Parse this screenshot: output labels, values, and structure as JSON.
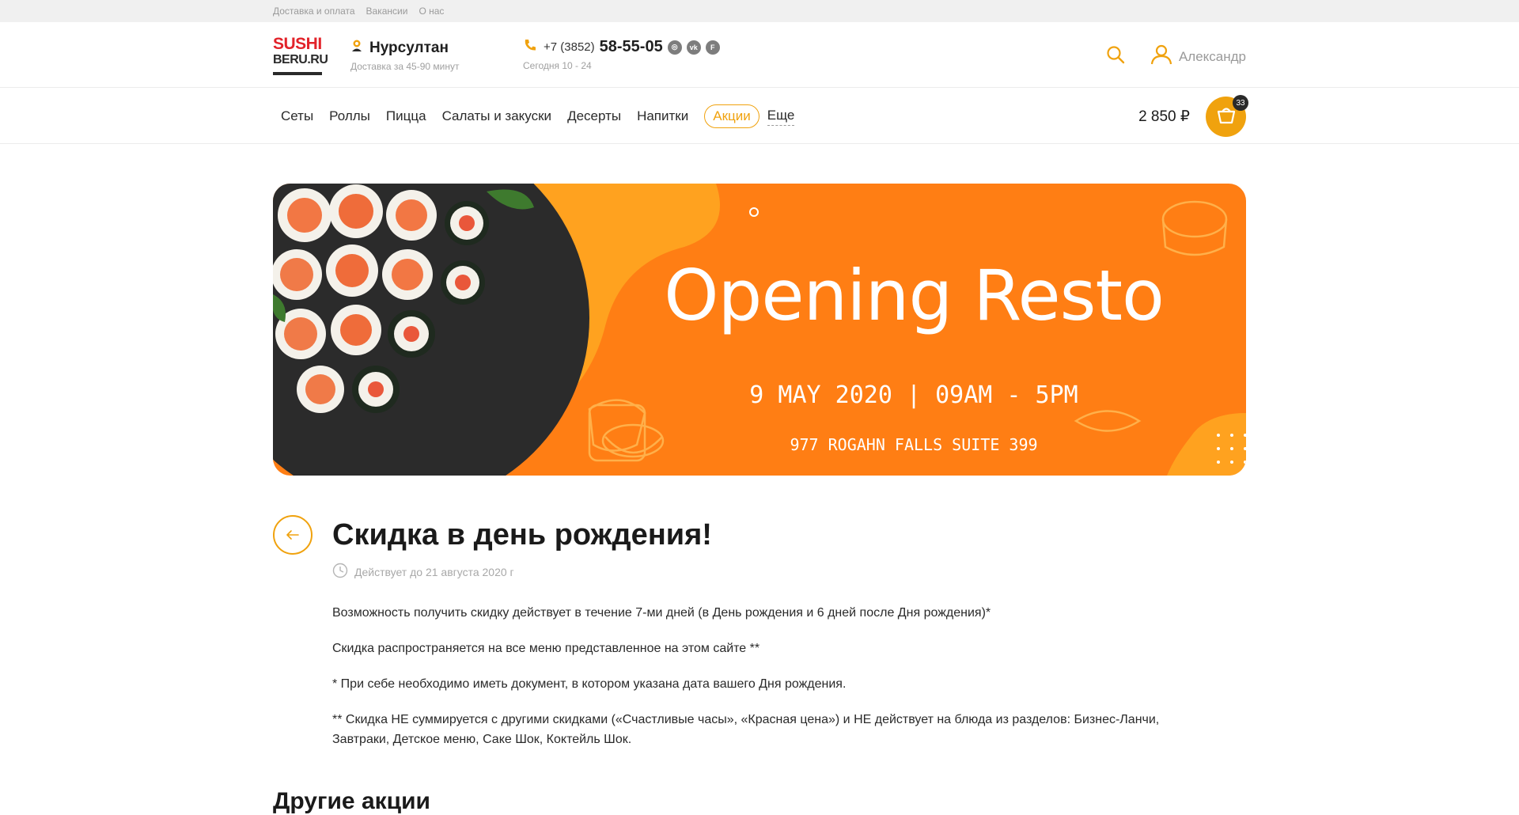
{
  "topbar": {
    "links": [
      "Доставка и оплата",
      "Вакансии",
      "О нас"
    ]
  },
  "header": {
    "logo": {
      "line1": "SUSHI",
      "line2": "BERU.RU"
    },
    "city": {
      "name": "Нурсултан",
      "delivery": "Доставка за 45-90 минут"
    },
    "phone": {
      "code": "+7 (3852)",
      "number": "58-55-05",
      "hours": "Сегодня 10 - 24"
    },
    "social": [
      "instagram-icon",
      "vk-icon",
      "foursquare-icon"
    ],
    "user_name": "Александр"
  },
  "nav": {
    "items": [
      "Сеты",
      "Роллы",
      "Пицца",
      "Салаты и закуски",
      "Десерты",
      "Напитки"
    ],
    "promo": "Акции",
    "more": "Еще",
    "cart_total": "2 850 ₽",
    "cart_count": "33"
  },
  "banner": {
    "title": "Opening Resto",
    "date": "9 MAY 2020 | 09AM - 5PM",
    "address": "977 ROGAHN FALLS SUITE 399"
  },
  "article": {
    "title": "Скидка в день рождения!",
    "valid_until": "Действует до 21 августа 2020 г",
    "paragraphs": [
      "Возможность получить скидку действует в течение 7-ми дней (в День рождения и 6 дней после Дня рождения)*",
      "Скидка распространяется на все меню представленное на этом сайте **",
      "* При себе необходимо иметь документ, в котором указана дата вашего Дня рождения.",
      "** Скидка НЕ суммируется с другими скидками («Счастливые часы», «Красная цена») и НЕ действует на блюда из разделов: Бизнес-Ланчи, Завтраки, Детское меню, Саке Шок, Коктейль Шок."
    ]
  },
  "other_promos_title": "Другие акции",
  "colors": {
    "accent": "#f0a20e",
    "banner": "#ff7e14",
    "logo_red": "#e2232a"
  }
}
